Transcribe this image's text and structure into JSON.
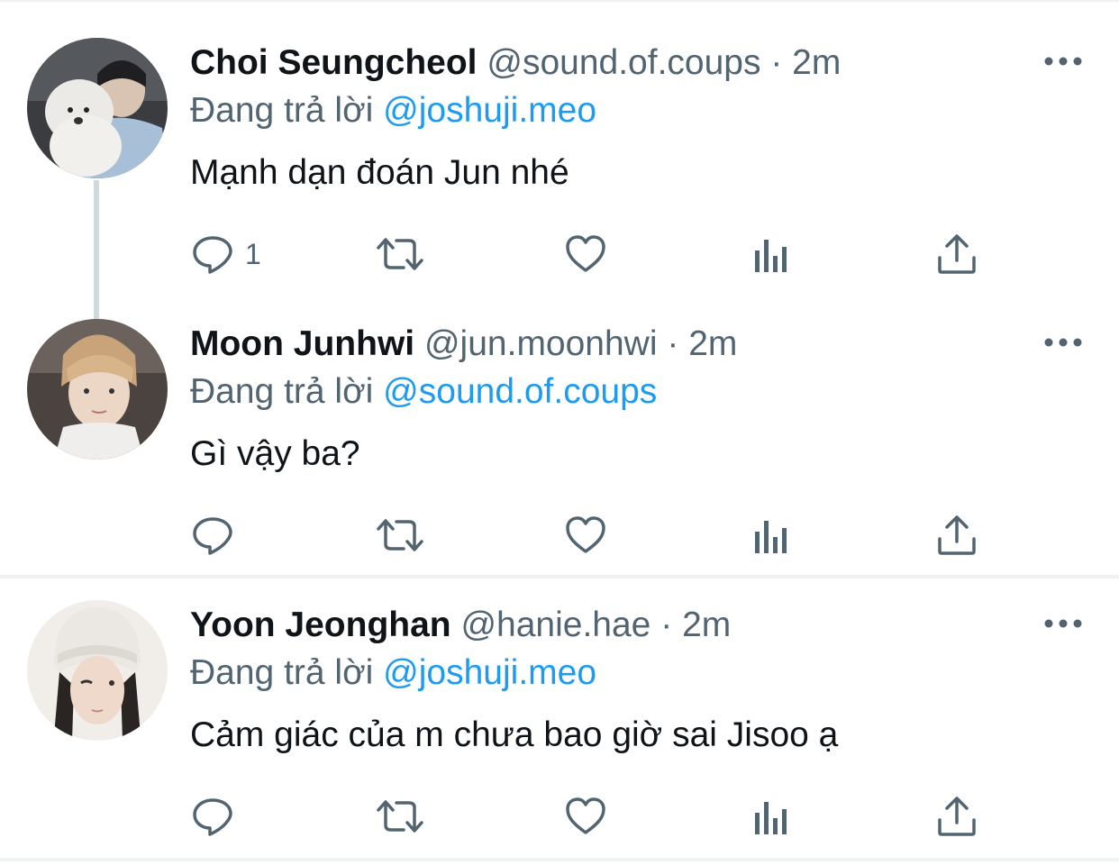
{
  "tweets": [
    {
      "name": "Choi Seungcheol",
      "handle": "@sound.of.coups",
      "separator": "·",
      "time": "2m",
      "replying_prefix": "Đang trả lời",
      "replying_to": "@joshuji.meo",
      "text": "Mạnh dạn đoán Jun nhé",
      "reply_count": "1",
      "avatar_icon": "avatar-photo"
    },
    {
      "name": "Moon Junhwi",
      "handle": "@jun.moonhwi",
      "separator": "·",
      "time": "2m",
      "replying_prefix": "Đang trả lời",
      "replying_to": "@sound.of.coups",
      "text": "Gì vậy ba?",
      "reply_count": "",
      "avatar_icon": "avatar-photo"
    },
    {
      "name": "Yoon Jeonghan",
      "handle": "@hanie.hae",
      "separator": "·",
      "time": "2m",
      "replying_prefix": "Đang trả lời",
      "replying_to": "@joshuji.meo",
      "text": "Cảm giác của m chưa bao giờ sai Jisoo ạ",
      "reply_count": "",
      "avatar_icon": "avatar-photo"
    }
  ],
  "colors": {
    "text": "#0f1419",
    "secondary": "#536471",
    "mention": "#1d9bf0",
    "thread_line": "#cfd9de",
    "divider": "#eff3f4"
  },
  "icons": [
    "reply-icon",
    "retweet-icon",
    "like-icon",
    "analytics-icon",
    "share-icon",
    "more-icon"
  ]
}
